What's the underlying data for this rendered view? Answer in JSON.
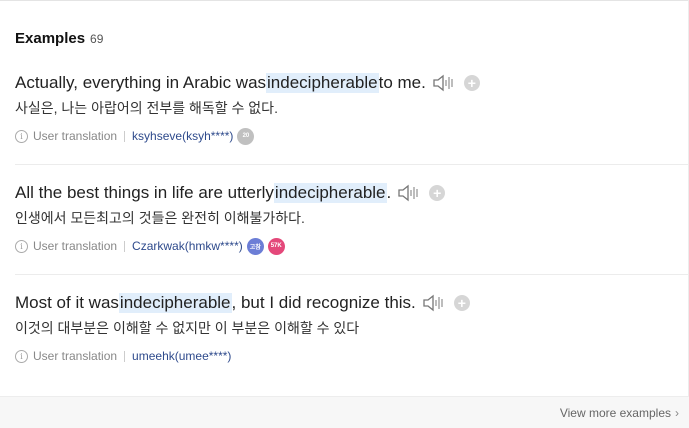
{
  "section": {
    "title": "Examples",
    "count": "69"
  },
  "examples": [
    {
      "pre": "Actually, everything in Arabic was ",
      "highlight": "indecipherable",
      "post": " to me.",
      "translation": "사실은, 나는 아랍어의 전부를 해독할 수 없다.",
      "source_label": "User translation",
      "user": "ksyhseve(ksyh****)",
      "badges": [
        "20"
      ]
    },
    {
      "pre": "All the best things in life are utterly ",
      "highlight": "indecipherable",
      "post": ".",
      "translation": "인생에서 모든최고의 것들은 완전히 이해불가하다.",
      "source_label": "User translation",
      "user": "Czarkwak(hmkw****)",
      "badges": [
        "고참",
        "57K"
      ]
    },
    {
      "pre": "Most of it was ",
      "highlight": "indecipherable",
      "post": ", but I did recognize this.",
      "translation": "이것의 대부분은 이해할 수 없지만 이 부분은 이해할 수 있다",
      "source_label": "User translation",
      "user": "umeehk(umee****)",
      "badges": []
    }
  ],
  "footer": {
    "view_more": "View more examples"
  },
  "icons": {
    "speaker": "speaker-icon",
    "add": "plus-icon",
    "info": "info-icon",
    "chevron": "chevron-right-icon"
  },
  "colors": {
    "highlight": "#e1eefb",
    "user_link": "#2e4a8c"
  }
}
